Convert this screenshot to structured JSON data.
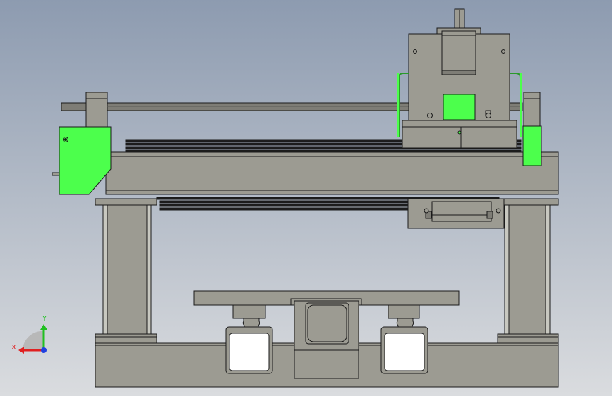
{
  "view": {
    "background_top": "#8d9bb0",
    "background_bottom": "#dadcdf"
  },
  "colors": {
    "metal": "#9c9b92",
    "metal_dark": "#7e7d76",
    "highlight": "#4cff4c",
    "line": "#1a1a1a",
    "rail": "#2a2a2a"
  },
  "triad": {
    "x_label": "X",
    "y_label": "Y",
    "x_color": "#e02020",
    "y_color": "#20c020",
    "z_color": "#2040e0"
  }
}
